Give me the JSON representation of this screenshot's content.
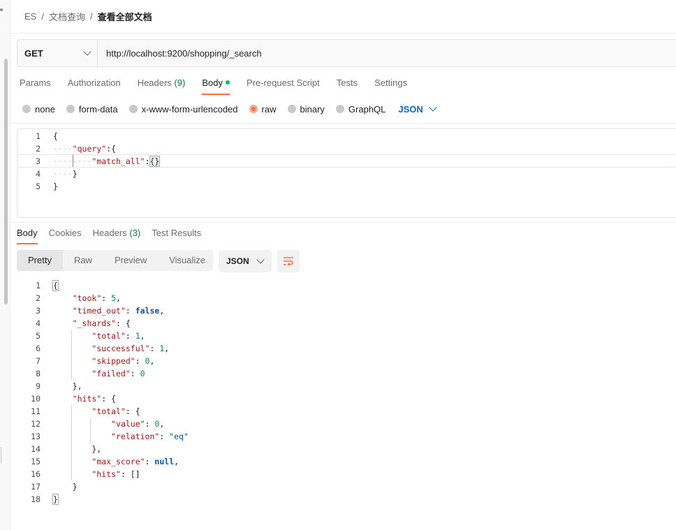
{
  "breadcrumb": {
    "items": [
      "ES",
      "文档查询"
    ],
    "current": "查看全部文档",
    "separator": "/"
  },
  "request": {
    "method": "GET",
    "url": "http://localhost:9200/shopping/_search"
  },
  "request_tabs": [
    {
      "label": "Params"
    },
    {
      "label": "Authorization"
    },
    {
      "label": "Headers",
      "count": "(9)"
    },
    {
      "label": "Body",
      "active": true
    },
    {
      "label": "Pre-request Script"
    },
    {
      "label": "Tests"
    },
    {
      "label": "Settings"
    }
  ],
  "body_types": {
    "options": [
      "none",
      "form-data",
      "x-www-form-urlencoded",
      "raw",
      "binary",
      "GraphQL"
    ],
    "selected": "raw",
    "language": "JSON"
  },
  "request_body": {
    "line_numbers": [
      "1",
      "2",
      "3",
      "4",
      "5"
    ],
    "l1": "{",
    "l2_ws": "····",
    "l2_key": "\"query\"",
    "l2_rest": ":{",
    "l3_ws": "········",
    "l3_key": "\"match_all\"",
    "l3_colon": ":",
    "l3_val": "{}",
    "l4_ws": "····",
    "l4_rest": "}",
    "l5": "}"
  },
  "response_tabs": [
    {
      "label": "Body",
      "active": true
    },
    {
      "label": "Cookies"
    },
    {
      "label": "Headers",
      "count": "(3)"
    },
    {
      "label": "Test Results"
    }
  ],
  "view_modes": [
    "Pretty",
    "Raw",
    "Preview",
    "Visualize"
  ],
  "format": "JSON",
  "icons": {
    "chevron": "chevron-down-icon",
    "wrap": "wrap-lines-icon"
  },
  "colors": {
    "accent": "#ff6c37",
    "json_select": "#0265d2",
    "count_green": "#0c7b3e",
    "body_dot": "#0cbb52"
  },
  "response_body": {
    "line_numbers": [
      "1",
      "2",
      "3",
      "4",
      "5",
      "6",
      "7",
      "8",
      "9",
      "10",
      "11",
      "12",
      "13",
      "14",
      "15",
      "16",
      "17",
      "18"
    ],
    "lines": [
      [
        {
          "t": "{",
          "c": ""
        }
      ],
      [
        {
          "t": "    ",
          "c": ""
        },
        {
          "t": "\"took\"",
          "c": "rk"
        },
        {
          "t": ": ",
          "c": ""
        },
        {
          "t": "5",
          "c": "rn"
        },
        {
          "t": ",",
          "c": ""
        }
      ],
      [
        {
          "t": "    ",
          "c": ""
        },
        {
          "t": "\"timed_out\"",
          "c": "rk"
        },
        {
          "t": ": ",
          "c": ""
        },
        {
          "t": "false",
          "c": "rb"
        },
        {
          "t": ",",
          "c": ""
        }
      ],
      [
        {
          "t": "    ",
          "c": ""
        },
        {
          "t": "\"_shards\"",
          "c": "rk"
        },
        {
          "t": ": {",
          "c": ""
        }
      ],
      [
        {
          "t": "        ",
          "c": ""
        },
        {
          "t": "\"total\"",
          "c": "rk"
        },
        {
          "t": ": ",
          "c": ""
        },
        {
          "t": "1",
          "c": "rn"
        },
        {
          "t": ",",
          "c": ""
        }
      ],
      [
        {
          "t": "        ",
          "c": ""
        },
        {
          "t": "\"successful\"",
          "c": "rk"
        },
        {
          "t": ": ",
          "c": ""
        },
        {
          "t": "1",
          "c": "rn"
        },
        {
          "t": ",",
          "c": ""
        }
      ],
      [
        {
          "t": "        ",
          "c": ""
        },
        {
          "t": "\"skipped\"",
          "c": "rk"
        },
        {
          "t": ": ",
          "c": ""
        },
        {
          "t": "0",
          "c": "rn"
        },
        {
          "t": ",",
          "c": ""
        }
      ],
      [
        {
          "t": "        ",
          "c": ""
        },
        {
          "t": "\"failed\"",
          "c": "rk"
        },
        {
          "t": ": ",
          "c": ""
        },
        {
          "t": "0",
          "c": "rn"
        }
      ],
      [
        {
          "t": "    },",
          "c": ""
        }
      ],
      [
        {
          "t": "    ",
          "c": ""
        },
        {
          "t": "\"hits\"",
          "c": "rk"
        },
        {
          "t": ": {",
          "c": ""
        }
      ],
      [
        {
          "t": "        ",
          "c": ""
        },
        {
          "t": "\"total\"",
          "c": "rk"
        },
        {
          "t": ": {",
          "c": ""
        }
      ],
      [
        {
          "t": "            ",
          "c": ""
        },
        {
          "t": "\"value\"",
          "c": "rk"
        },
        {
          "t": ": ",
          "c": ""
        },
        {
          "t": "0",
          "c": "rn"
        },
        {
          "t": ",",
          "c": ""
        }
      ],
      [
        {
          "t": "            ",
          "c": ""
        },
        {
          "t": "\"relation\"",
          "c": "rk"
        },
        {
          "t": ": ",
          "c": ""
        },
        {
          "t": "\"eq\"",
          "c": "rs"
        }
      ],
      [
        {
          "t": "        },",
          "c": ""
        }
      ],
      [
        {
          "t": "        ",
          "c": ""
        },
        {
          "t": "\"max_score\"",
          "c": "rk"
        },
        {
          "t": ": ",
          "c": ""
        },
        {
          "t": "null",
          "c": "rb"
        },
        {
          "t": ",",
          "c": ""
        }
      ],
      [
        {
          "t": "        ",
          "c": ""
        },
        {
          "t": "\"hits\"",
          "c": "rk"
        },
        {
          "t": ": []",
          "c": ""
        }
      ],
      [
        {
          "t": "    }",
          "c": ""
        }
      ],
      [
        {
          "t": "}",
          "c": ""
        }
      ]
    ]
  }
}
